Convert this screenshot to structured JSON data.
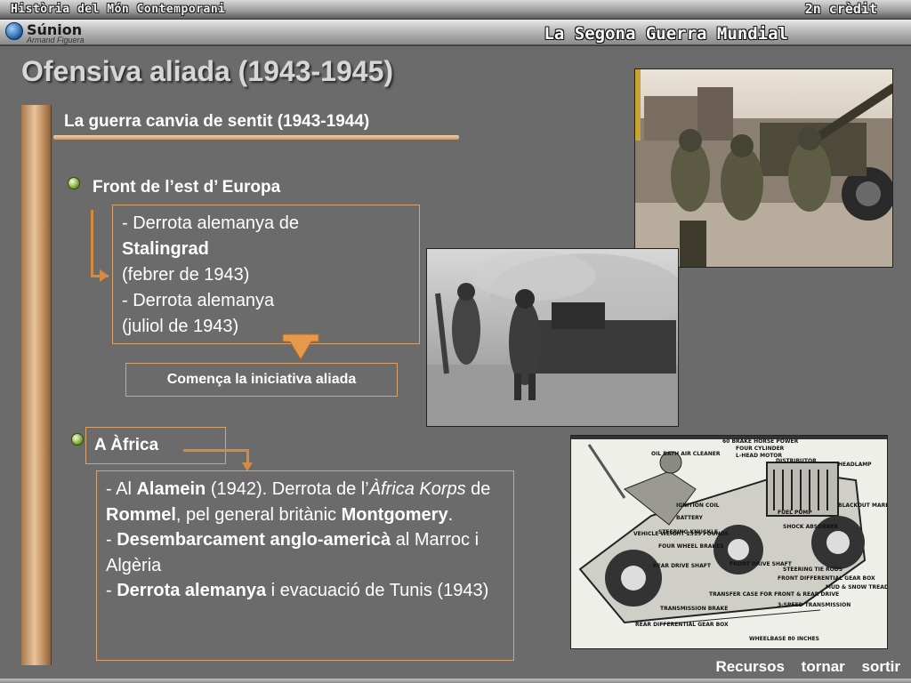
{
  "header": {
    "course": "Història del Món Contemporani",
    "credit": "2n crèdit",
    "brand": "Súnion",
    "author": "Armand Figuera",
    "unit_title": "La Segona Guerra Mundial"
  },
  "page": {
    "title": "Ofensiva aliada (1943-1945)",
    "section_title": "La guerra canvia de sentit (1943-1944)"
  },
  "east_front": {
    "label": "Front de l’est d’ Europa",
    "line1": "- Derrota alemanya de",
    "line2": "Stalingrad",
    "line3": "(febrer de 1943)",
    "line4": "- Derrota alemanya",
    "line5": "(juliol de 1943)",
    "initiative": "Comença la iniciativa aliada"
  },
  "africa": {
    "label": "A Àfrica",
    "p1_a": "- Al ",
    "p1_b": "Alamein",
    "p1_c": " (1942). Derrota de l’",
    "p1_d": "Àfrica Korps",
    "p1_e": " de ",
    "p1_f": "Rommel",
    "p1_g": ", pel general britànic ",
    "p1_h": "Montgomery",
    "p1_i": ".",
    "p2_a": "- ",
    "p2_b": "Desembarcament anglo-americà",
    "p2_c": " al Marroc i Algèria",
    "p3_a": "- ",
    "p3_b": "Derrota alemanya",
    "p3_c": " i evacuació de Tunis (1943)"
  },
  "jeep_labels": [
    "60 BRAKE HORSE POWER",
    "FOUR CYLINDER",
    "L-HEAD MOTOR",
    "OIL BATH AIR CLEANER",
    "DISTRIBUTOR",
    "HEADLAMP",
    "IGNITION COIL",
    "BATTERY",
    "STEERING KNUCKLE",
    "FUEL PUMP",
    "SHOCK ABSORBER",
    "BLACKOUT MARKER LAMP",
    "VEHICLE WEIGHT 2315 POUNDS",
    "FOUR WHEEL BRAKES",
    "REAR DRIVE SHAFT",
    "FRONT DRIVE SHAFT",
    "STEERING TIE RODS",
    "FRONT DIFFERENTIAL GEAR BOX",
    "TRANSFER CASE FOR FRONT & REAR DRIVE",
    "3-SPEED TRANSMISSION",
    "MUD & SNOW TREAD TIRES",
    "TRANSMISSION BRAKE",
    "REAR DIFFERENTIAL GEAR BOX",
    "WHEELBASE 80 INCHES"
  ],
  "footer": {
    "resources": "Recursos",
    "back": "tornar",
    "exit": "sortir"
  }
}
